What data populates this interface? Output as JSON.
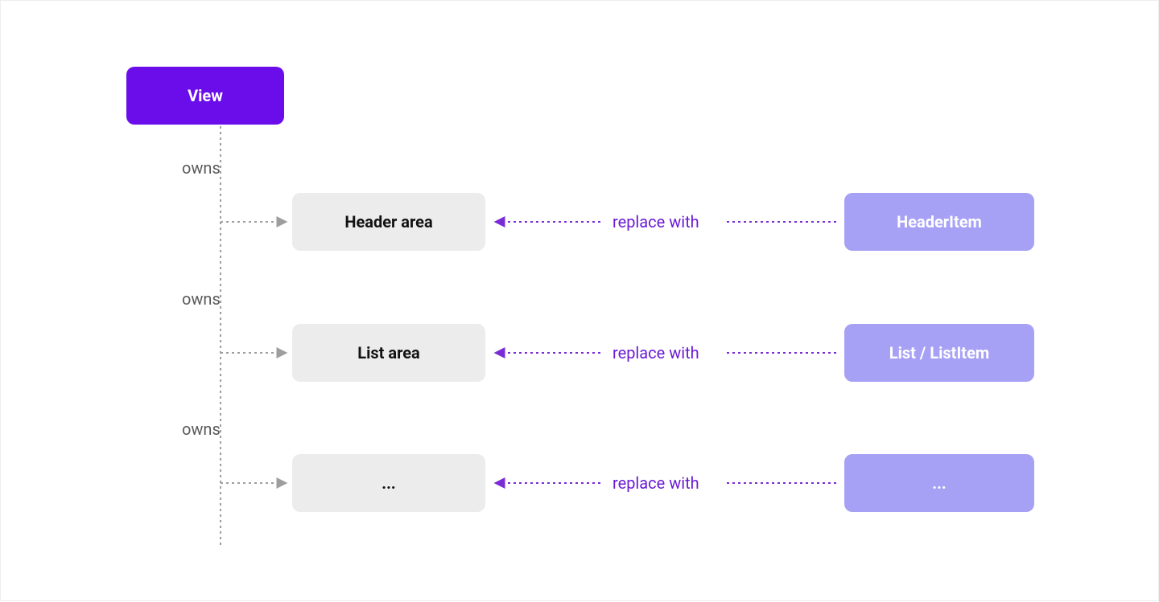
{
  "root": {
    "label": "View"
  },
  "owns_label": "owns",
  "replace_label": "replace with",
  "rows": [
    {
      "area": "Header  area",
      "component": "HeaderItem"
    },
    {
      "area": "List area",
      "component": "List / ListItem"
    },
    {
      "area": "...",
      "component": "..."
    }
  ],
  "colors": {
    "primary": "#6a0dea",
    "area_bg": "#ececec",
    "comp_bg": "#a7a1f5",
    "owns_text": "#5a5a5a",
    "replace_text": "#6b1bd6",
    "gray_dash": "#9e9e9e",
    "purple_dash": "#792bd6"
  }
}
